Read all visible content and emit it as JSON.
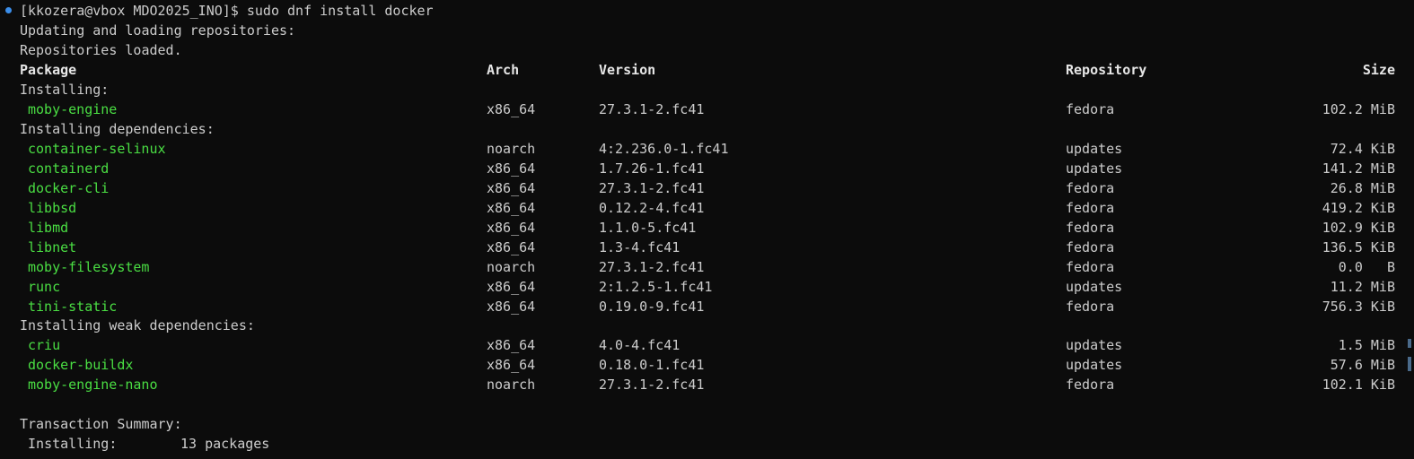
{
  "terminal": {
    "prompt": "[kkozera@vbox MDO2025_INO]$ ",
    "command": "sudo dnf install docker",
    "lines": {
      "updating": "Updating and loading repositories:",
      "loaded": "Repositories loaded."
    },
    "header": {
      "package": "Package",
      "arch": "Arch",
      "version": "Version",
      "repository": "Repository",
      "size": "Size"
    },
    "sections": {
      "installing": "Installing:",
      "deps": "Installing dependencies:",
      "weak": "Installing weak dependencies:"
    },
    "installing": [
      {
        "name": "moby-engine",
        "arch": "x86_64",
        "version": "27.3.1-2.fc41",
        "repo": "fedora",
        "size": "102.2 MiB"
      }
    ],
    "deps": [
      {
        "name": "container-selinux",
        "arch": "noarch",
        "version": "4:2.236.0-1.fc41",
        "repo": "updates",
        "size": "72.4 KiB"
      },
      {
        "name": "containerd",
        "arch": "x86_64",
        "version": "1.7.26-1.fc41",
        "repo": "updates",
        "size": "141.2 MiB"
      },
      {
        "name": "docker-cli",
        "arch": "x86_64",
        "version": "27.3.1-2.fc41",
        "repo": "fedora",
        "size": "26.8 MiB"
      },
      {
        "name": "libbsd",
        "arch": "x86_64",
        "version": "0.12.2-4.fc41",
        "repo": "fedora",
        "size": "419.2 KiB"
      },
      {
        "name": "libmd",
        "arch": "x86_64",
        "version": "1.1.0-5.fc41",
        "repo": "fedora",
        "size": "102.9 KiB"
      },
      {
        "name": "libnet",
        "arch": "x86_64",
        "version": "1.3-4.fc41",
        "repo": "fedora",
        "size": "136.5 KiB"
      },
      {
        "name": "moby-filesystem",
        "arch": "noarch",
        "version": "27.3.1-2.fc41",
        "repo": "fedora",
        "size": "0.0   B"
      },
      {
        "name": "runc",
        "arch": "x86_64",
        "version": "2:1.2.5-1.fc41",
        "repo": "updates",
        "size": "11.2 MiB"
      },
      {
        "name": "tini-static",
        "arch": "x86_64",
        "version": "0.19.0-9.fc41",
        "repo": "fedora",
        "size": "756.3 KiB"
      }
    ],
    "weak": [
      {
        "name": "criu",
        "arch": "x86_64",
        "version": "4.0-4.fc41",
        "repo": "updates",
        "size": "1.5 MiB"
      },
      {
        "name": "docker-buildx",
        "arch": "x86_64",
        "version": "0.18.0-1.fc41",
        "repo": "updates",
        "size": "57.6 MiB"
      },
      {
        "name": "moby-engine-nano",
        "arch": "noarch",
        "version": "27.3.1-2.fc41",
        "repo": "fedora",
        "size": "102.1 KiB"
      }
    ],
    "summary": {
      "title": "Transaction Summary:",
      "installing_label": " Installing:",
      "installing_value": "13 packages"
    },
    "colors": {
      "background": "#0c0c0c",
      "text": "#cccccc",
      "package_name": "#4ade43",
      "prompt_marker": "#3b8eea"
    }
  }
}
